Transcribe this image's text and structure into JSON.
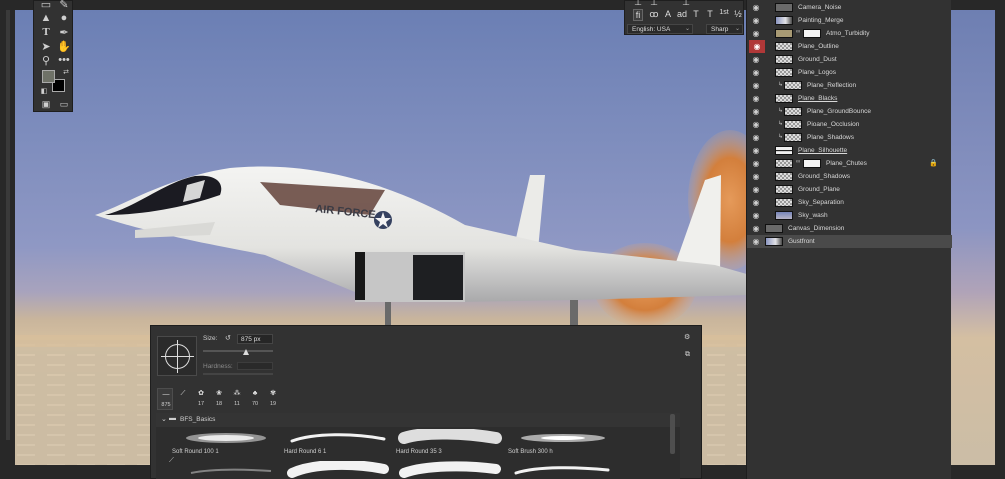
{
  "text_options": {
    "language": "English: USA",
    "antialias": "Sharp",
    "icon_names": [
      "ligature-fi-icon",
      "oldstyle-icon",
      "swash-icon",
      "ordinal-icon",
      "titling-icon",
      "contextual-icon",
      "ordinals-st-icon",
      "fraction-icon"
    ],
    "glyphs": [
      "fi",
      "ꝏ",
      "A",
      "ad",
      "T",
      "T",
      "1st",
      "½"
    ]
  },
  "layers": [
    {
      "name": "Camera_Noise",
      "thumb": "gray",
      "eye": true
    },
    {
      "name": "Painting_Merge",
      "thumb": "image",
      "eye": true
    },
    {
      "name": "Atmo_Turbidity",
      "thumb": "tan",
      "mask": true,
      "link": true,
      "eye": true
    },
    {
      "name": "Plane_Outline",
      "thumb": "checker",
      "eye": true,
      "eye_red": true
    },
    {
      "name": "Ground_Dust",
      "thumb": "checker",
      "eye": true
    },
    {
      "name": "Plane_Logos",
      "thumb": "checker",
      "eye": true
    },
    {
      "name": "Plane_Reflection",
      "thumb": "checker",
      "clipped": true,
      "eye": true
    },
    {
      "name": "Plane_Blacks",
      "thumb": "checker",
      "eye": true,
      "underline": true
    },
    {
      "name": "Plane_GroundBounce",
      "thumb": "checker",
      "clipped": true,
      "eye": true
    },
    {
      "name": "Pioane_Occlusion",
      "thumb": "checker",
      "clipped": true,
      "eye": true
    },
    {
      "name": "Plane_Shadows",
      "thumb": "checker",
      "clipped": true,
      "eye": true
    },
    {
      "name": "Plane_Silhouette",
      "thumb": "silhouette",
      "eye": true,
      "underline": true
    },
    {
      "name": "Plane_Chutes",
      "thumb": "checker",
      "mask": true,
      "link": true,
      "lock": true,
      "eye": true
    },
    {
      "name": "Ground_Shadows",
      "thumb": "checker",
      "eye": true
    },
    {
      "name": "Ground_Plane",
      "thumb": "checker",
      "eye": true
    },
    {
      "name": "Sky_Separation",
      "thumb": "checker",
      "eye": true
    },
    {
      "name": "Sky_wash",
      "thumb": "sky",
      "eye": true
    },
    {
      "name": "Canvas_Dimension",
      "thumb": "gray",
      "eye": true,
      "wide": true
    },
    {
      "name": "Gustfront",
      "thumb": "image",
      "eye": true,
      "selected": true,
      "wide": true
    }
  ],
  "brush_panel": {
    "size_label": "Size:",
    "size_value": "875 px",
    "size_fraction": 0.62,
    "hardness_label": "Hardness:",
    "recent_brushes": [
      "875",
      "",
      "17",
      "18",
      "11",
      "70",
      "19"
    ],
    "folder_name": "BFS_Basics",
    "brushes": [
      {
        "name": "Soft Round 100 1"
      },
      {
        "name": "Hard Round 6 1"
      },
      {
        "name": "Hard Round 35 3"
      },
      {
        "name": "Soft Brush 300 h"
      }
    ]
  },
  "colors": {
    "foreground": "#6f7268",
    "background": "#000000",
    "eye_highlight": "#b03838"
  },
  "canvas": {
    "aircraft_text": "AIR FORCE"
  }
}
